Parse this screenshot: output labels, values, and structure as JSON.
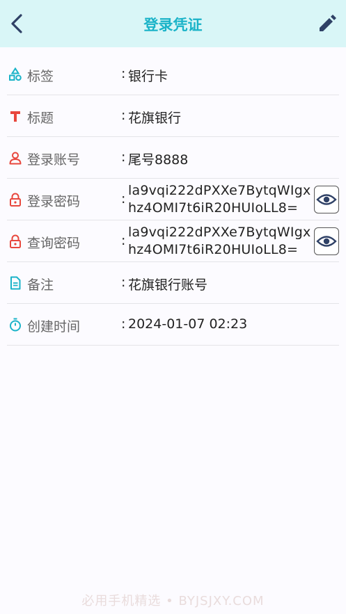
{
  "header": {
    "title": "登录凭证"
  },
  "rows": [
    {
      "label": "标签",
      "value": "银行卡"
    },
    {
      "label": "标题",
      "value": "花旗银行"
    },
    {
      "label": "登录账号",
      "value": "尾号8888"
    },
    {
      "label": "登录密码",
      "value": "la9vqi222dPXXe7BytqWIgxhz4OMI7t6iR20HUIoLL8="
    },
    {
      "label": "查询密码",
      "value": "la9vqi222dPXXe7BytqWIgxhz4OMI7t6iR20HUIoLL8="
    },
    {
      "label": "备注",
      "value": "花旗银行账号"
    },
    {
      "label": "创建时间",
      "value": "2024-01-07 02:23"
    }
  ],
  "separator": ":",
  "watermark": "必用手机精选 • BYJSJXY.COM",
  "colors": {
    "accent": "#1ab3c8",
    "red": "#e8473d",
    "header_bg": "#d9f6f7"
  }
}
